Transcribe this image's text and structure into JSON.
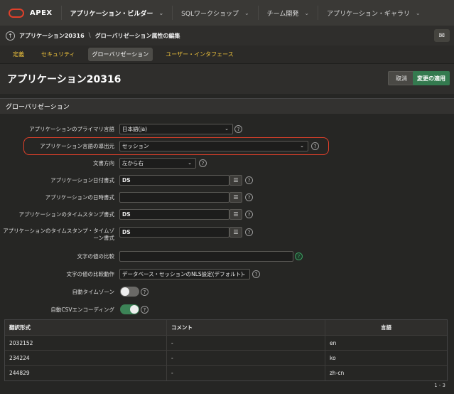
{
  "topbar": {
    "brand": "APEX",
    "nav": [
      {
        "label": "アプリケーション・ビルダー",
        "active": true
      },
      {
        "label": "SQLワークショップ",
        "active": false
      },
      {
        "label": "チーム開発",
        "active": false
      },
      {
        "label": "アプリケーション・ギャラリ",
        "active": false
      }
    ]
  },
  "breadcrumb": {
    "app": "アプリケーション20316",
    "page": "グローバリゼーション属性の編集"
  },
  "tabs": [
    {
      "label": "定義",
      "active": false
    },
    {
      "label": "セキュリティ",
      "active": false
    },
    {
      "label": "グローバリゼーション",
      "active": true
    },
    {
      "label": "ユーザー・インタフェース",
      "active": false
    }
  ],
  "page": {
    "title": "アプリケーション20316",
    "cancel_label": "取消",
    "apply_label": "変更の適用"
  },
  "region": {
    "title": "グローバリゼーション"
  },
  "form": {
    "primary_language": {
      "label": "アプリケーションのプライマリ言語",
      "value": "日本語(ja)"
    },
    "language_derived_from": {
      "label": "アプリケーション言語の導出元",
      "value": "セッション"
    },
    "document_direction": {
      "label": "文書方向",
      "value": "左から右"
    },
    "date_format": {
      "label": "アプリケーション日付書式",
      "value": "DS"
    },
    "datetime_format": {
      "label": "アプリケーションの日時書式",
      "value": ""
    },
    "timestamp_format": {
      "label": "アプリケーションのタイムスタンプ書式",
      "value": "DS"
    },
    "timestamp_tz_format": {
      "label": "アプリケーションのタイムスタンプ・タイムゾーン書式",
      "value": "DS"
    },
    "character_comparison": {
      "label": "文字の値の比較",
      "value": ""
    },
    "character_comparison_behavior": {
      "label": "文字の値の比較動作",
      "value": "データベース・セッションのNLS設定(デフォルト)"
    },
    "auto_time_zone": {
      "label": "自動タイムゾーン",
      "on": false
    },
    "auto_csv_encoding": {
      "label": "自動CSVエンコーディング",
      "on": true
    }
  },
  "translations": {
    "columns": [
      "翻訳形式",
      "コメント",
      "言語"
    ],
    "rows": [
      [
        "2032152",
        "-",
        "en"
      ],
      [
        "234224",
        "-",
        "ko"
      ],
      [
        "244829",
        "-",
        "zh-cn"
      ]
    ],
    "pager": "1 - 3"
  },
  "colors": {
    "accent_red": "#e0402a",
    "apply_green": "#347a4f",
    "tab_yellow": "#f0c43c"
  }
}
